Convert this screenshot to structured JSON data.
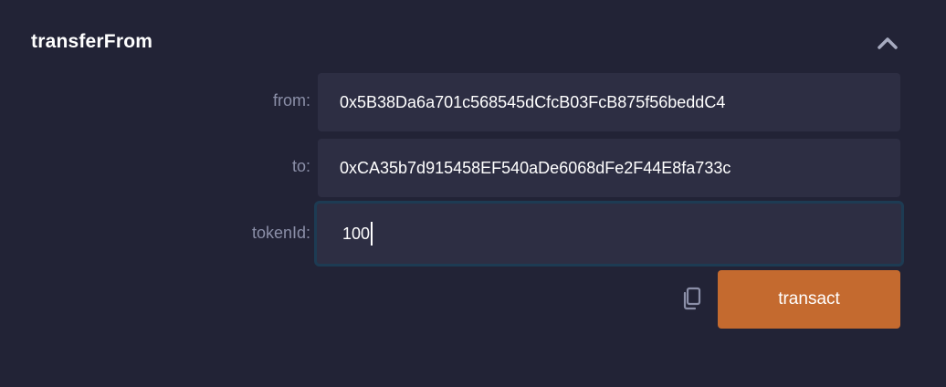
{
  "function": {
    "name": "transferFrom",
    "collapse_icon": "chevron-up-icon"
  },
  "params": {
    "from": {
      "label": "from:",
      "value": "0x5B38Da6a701c568545dCfcB03FcB875f56beddC4"
    },
    "to": {
      "label": "to:",
      "value": "0xCA35b7d915458EF540aDe6068dFe2F44E8fa733c"
    },
    "tokenId": {
      "label": "tokenId:",
      "value": "100"
    }
  },
  "actions": {
    "copy_icon": "copy-icon",
    "transact_label": "transact"
  },
  "colors": {
    "background": "#222336",
    "field": "#2d2e43",
    "label": "#8b8fa8",
    "accent": "#c46a2f",
    "focus_border": "#1d3b53"
  }
}
